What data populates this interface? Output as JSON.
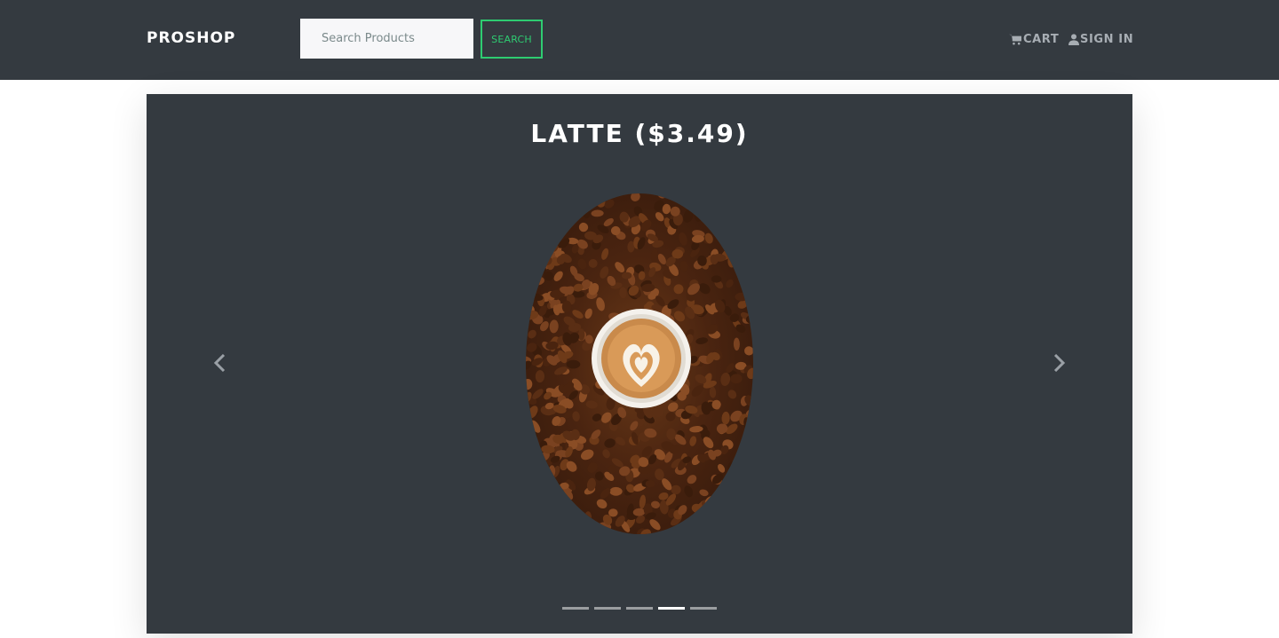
{
  "header": {
    "brand": "PROSHOP",
    "search": {
      "placeholder": "Search Products",
      "value": "",
      "button_label": "SEARCH"
    },
    "nav": [
      {
        "label": "CART",
        "icon": "cart-icon"
      },
      {
        "label": "SIGN IN",
        "icon": "user-icon"
      }
    ]
  },
  "carousel": {
    "slide_title": "LATTE ($3.49)",
    "slide_count": 5,
    "active_index": 3,
    "controls": {
      "prev_icon": "chevron-left-icon",
      "next_icon": "chevron-right-icon"
    }
  },
  "colors": {
    "navbar_bg": "#343a40",
    "accent": "#2ecc71",
    "nav_link": "#a7adb3"
  }
}
